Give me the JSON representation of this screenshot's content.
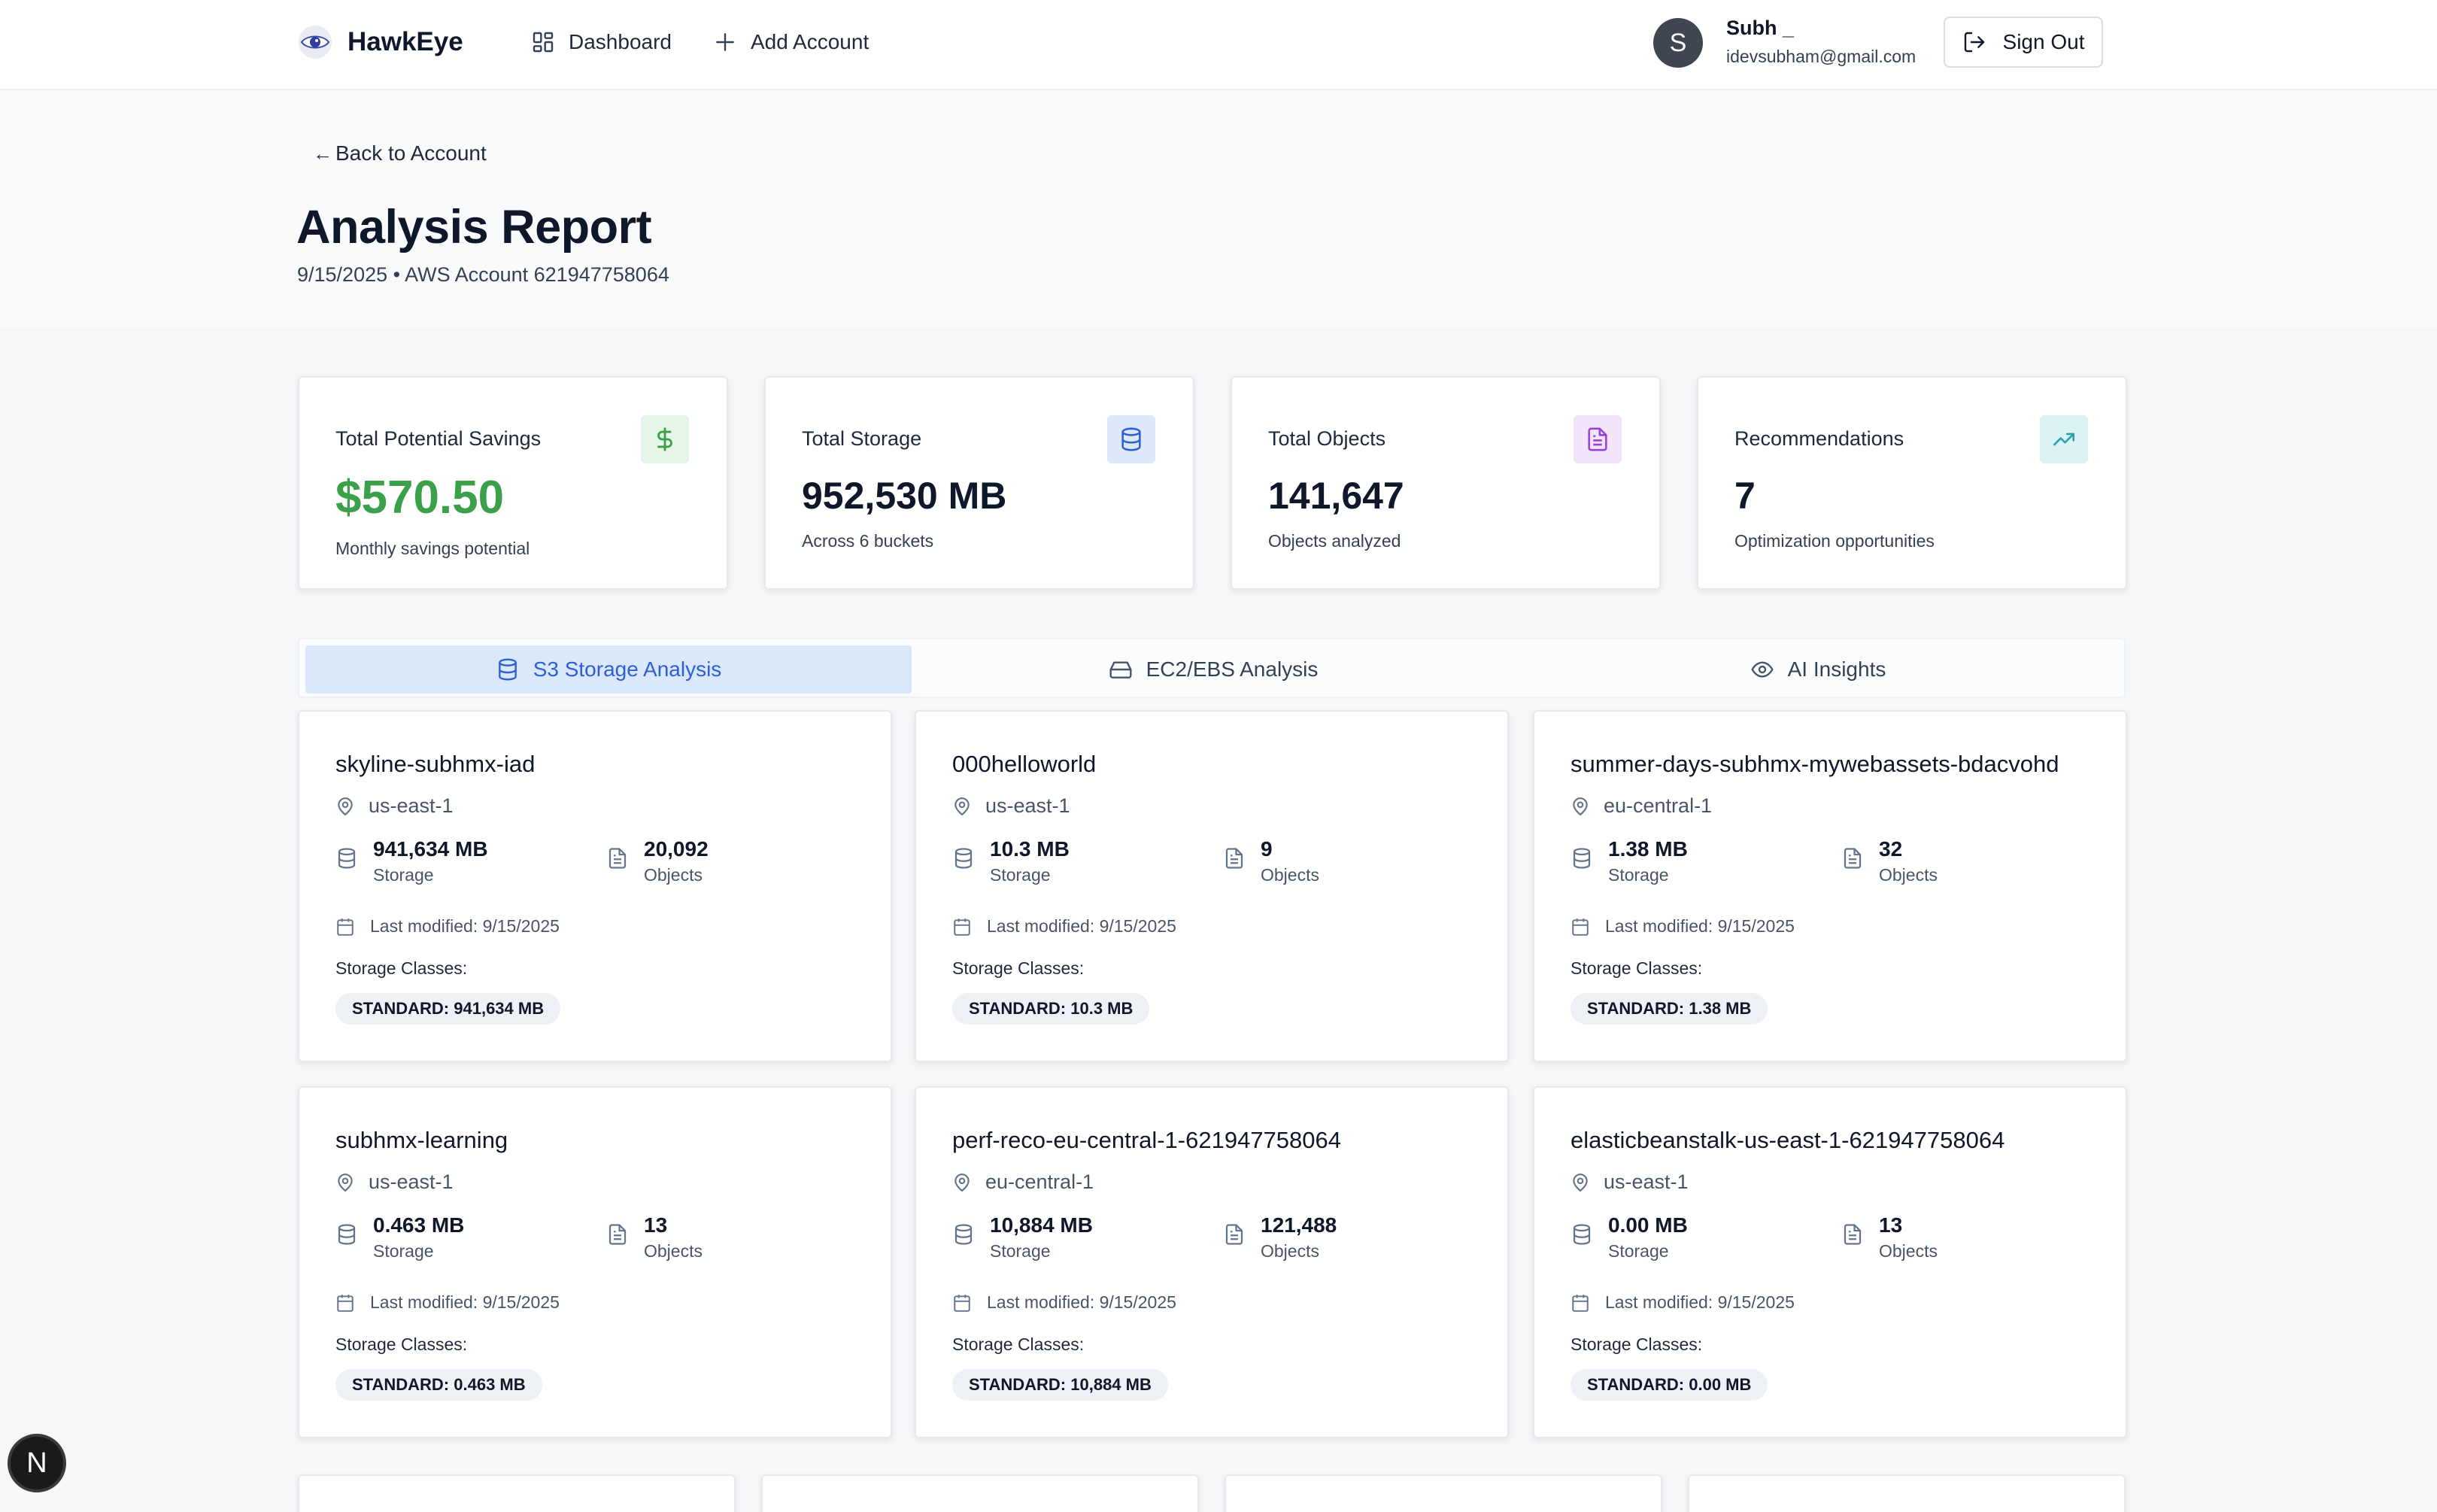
{
  "nav": {
    "brand": "HawkEye",
    "dashboard_label": "Dashboard",
    "add_account_label": "Add Account",
    "user_initial": "S",
    "user_name": "Subh _",
    "user_email": "idevsubham@gmail.com",
    "sign_out_label": "Sign Out"
  },
  "header": {
    "back_label": "Back to Account",
    "title": "Analysis Report",
    "subtitle": "9/15/2025 • AWS Account 621947758064"
  },
  "summary": [
    {
      "label": "Total Potential Savings",
      "value": "$570.50",
      "sub": "Monthly savings potential",
      "icon": "dollar-icon"
    },
    {
      "label": "Total Storage",
      "value": "952,530 MB",
      "sub": "Across 6 buckets",
      "icon": "database-icon"
    },
    {
      "label": "Total Objects",
      "value": "141,647",
      "sub": "Objects analyzed",
      "icon": "file-icon"
    },
    {
      "label": "Recommendations",
      "value": "7",
      "sub": "Optimization opportunities",
      "icon": "trending-up-icon"
    }
  ],
  "tabs": [
    {
      "label": "S3 Storage Analysis",
      "icon": "database-icon",
      "active": true
    },
    {
      "label": "EC2/EBS Analysis",
      "icon": "hard-drive-icon",
      "active": false
    },
    {
      "label": "AI Insights",
      "icon": "eye-icon",
      "active": false
    }
  ],
  "buckets": [
    {
      "name": "skyline-subhmx-iad",
      "region": "us-east-1",
      "storage": "941,634 MB",
      "storage_label": "Storage",
      "objects": "20,092",
      "objects_label": "Objects",
      "modified": "Last modified: 9/15/2025",
      "classes_label": "Storage Classes:",
      "badge": "STANDARD: 941,634 MB"
    },
    {
      "name": "000helloworld",
      "region": "us-east-1",
      "storage": "10.3 MB",
      "storage_label": "Storage",
      "objects": "9",
      "objects_label": "Objects",
      "modified": "Last modified: 9/15/2025",
      "classes_label": "Storage Classes:",
      "badge": "STANDARD: 10.3 MB"
    },
    {
      "name": "summer-days-subhmx-mywebassets-bdacvohd",
      "region": "eu-central-1",
      "storage": "1.38 MB",
      "storage_label": "Storage",
      "objects": "32",
      "objects_label": "Objects",
      "modified": "Last modified: 9/15/2025",
      "classes_label": "Storage Classes:",
      "badge": "STANDARD: 1.38 MB"
    },
    {
      "name": "subhmx-learning",
      "region": "us-east-1",
      "storage": "0.463 MB",
      "storage_label": "Storage",
      "objects": "13",
      "objects_label": "Objects",
      "modified": "Last modified: 9/15/2025",
      "classes_label": "Storage Classes:",
      "badge": "STANDARD: 0.463 MB"
    },
    {
      "name": "perf-reco-eu-central-1-621947758064",
      "region": "eu-central-1",
      "storage": "10,884 MB",
      "storage_label": "Storage",
      "objects": "121,488",
      "objects_label": "Objects",
      "modified": "Last modified: 9/15/2025",
      "classes_label": "Storage Classes:",
      "badge": "STANDARD: 10,884 MB"
    },
    {
      "name": "elasticbeanstalk-us-east-1-621947758064",
      "region": "us-east-1",
      "storage": "0.00 MB",
      "storage_label": "Storage",
      "objects": "13",
      "objects_label": "Objects",
      "modified": "Last modified: 9/15/2025",
      "classes_label": "Storage Classes:",
      "badge": "STANDARD: 0.00 MB"
    }
  ],
  "dev_badge": "N",
  "colors": {
    "accent": "#2d5fd6",
    "savings_green": "#3aa04a",
    "active_tab_bg": "#dbe8fb"
  }
}
